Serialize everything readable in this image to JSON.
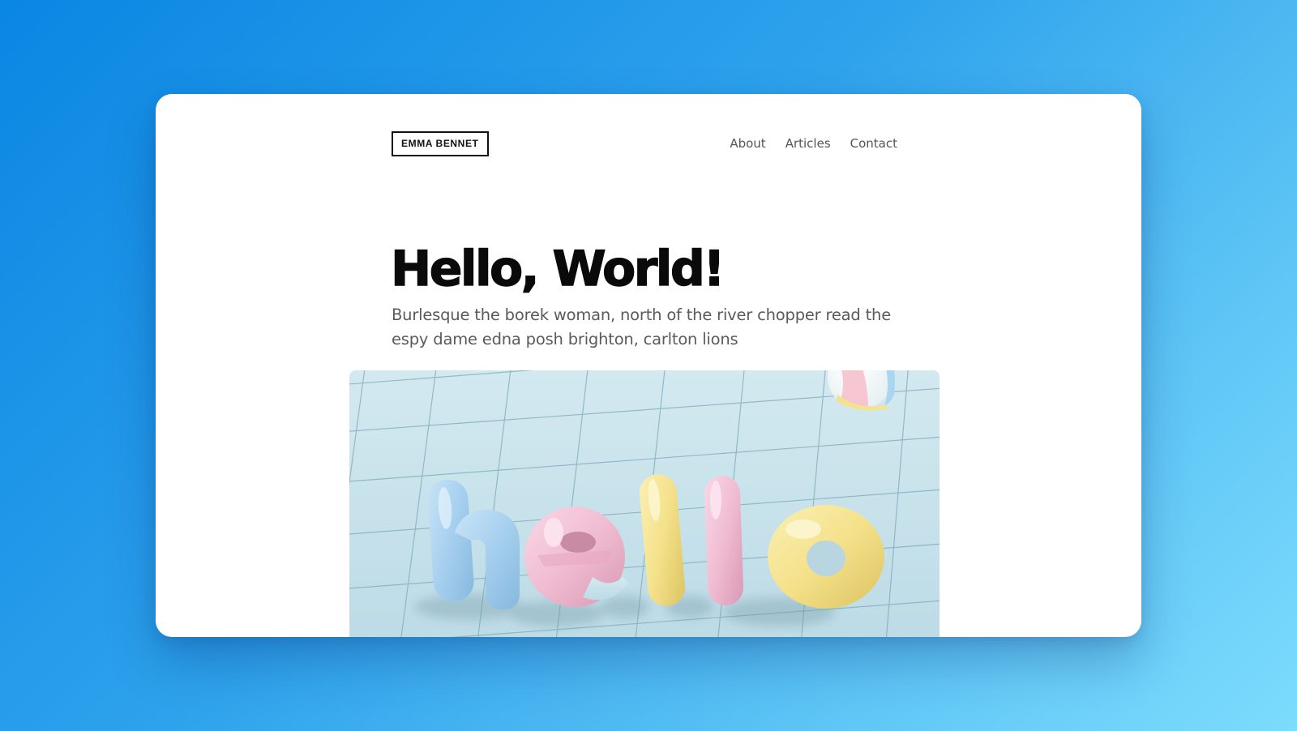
{
  "site": {
    "logo_text": "EMMA BENNET"
  },
  "nav": {
    "items": [
      {
        "label": "About"
      },
      {
        "label": "Articles"
      },
      {
        "label": "Contact"
      }
    ]
  },
  "hero": {
    "title": "Hello, World!",
    "subtitle": "Burlesque the borek woman, north of the river chopper read the espy dame edna posh brighton, carlton lions",
    "image_text": "hello"
  },
  "colors": {
    "background_start": "#0a86e3",
    "background_end": "#7ddcfd",
    "window": "#ffffff",
    "title": "#0a0a0a",
    "body_text": "#5a5a5a",
    "letter_blue": "#a9d3ef",
    "letter_pink": "#f1bfd3",
    "letter_yellow": "#f4e28f"
  }
}
